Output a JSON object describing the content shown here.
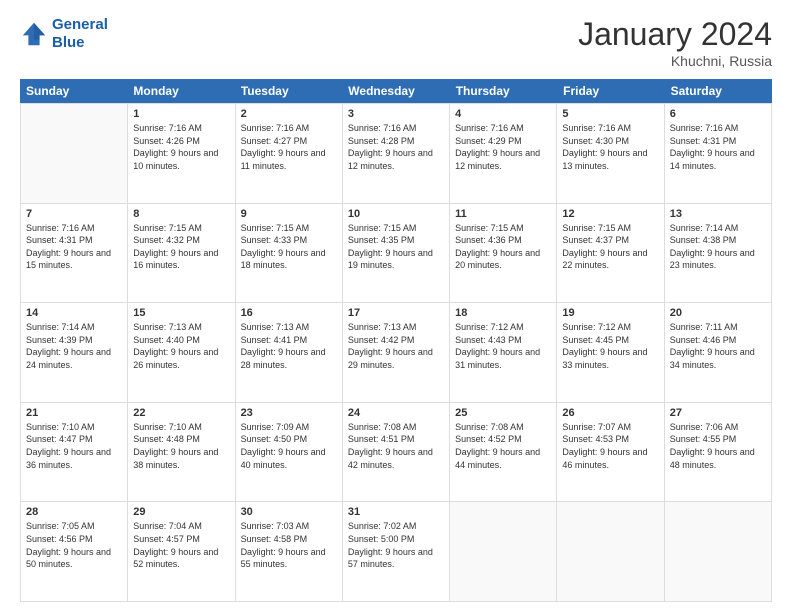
{
  "logo": {
    "line1": "General",
    "line2": "Blue"
  },
  "title": "January 2024",
  "location": "Khuchni, Russia",
  "days_of_week": [
    "Sunday",
    "Monday",
    "Tuesday",
    "Wednesday",
    "Thursday",
    "Friday",
    "Saturday"
  ],
  "weeks": [
    [
      {
        "day": "",
        "sunrise": "",
        "sunset": "",
        "daylight": ""
      },
      {
        "day": "1",
        "sunrise": "Sunrise: 7:16 AM",
        "sunset": "Sunset: 4:26 PM",
        "daylight": "Daylight: 9 hours and 10 minutes."
      },
      {
        "day": "2",
        "sunrise": "Sunrise: 7:16 AM",
        "sunset": "Sunset: 4:27 PM",
        "daylight": "Daylight: 9 hours and 11 minutes."
      },
      {
        "day": "3",
        "sunrise": "Sunrise: 7:16 AM",
        "sunset": "Sunset: 4:28 PM",
        "daylight": "Daylight: 9 hours and 12 minutes."
      },
      {
        "day": "4",
        "sunrise": "Sunrise: 7:16 AM",
        "sunset": "Sunset: 4:29 PM",
        "daylight": "Daylight: 9 hours and 12 minutes."
      },
      {
        "day": "5",
        "sunrise": "Sunrise: 7:16 AM",
        "sunset": "Sunset: 4:30 PM",
        "daylight": "Daylight: 9 hours and 13 minutes."
      },
      {
        "day": "6",
        "sunrise": "Sunrise: 7:16 AM",
        "sunset": "Sunset: 4:31 PM",
        "daylight": "Daylight: 9 hours and 14 minutes."
      }
    ],
    [
      {
        "day": "7",
        "sunrise": "Sunrise: 7:16 AM",
        "sunset": "Sunset: 4:31 PM",
        "daylight": "Daylight: 9 hours and 15 minutes."
      },
      {
        "day": "8",
        "sunrise": "Sunrise: 7:15 AM",
        "sunset": "Sunset: 4:32 PM",
        "daylight": "Daylight: 9 hours and 16 minutes."
      },
      {
        "day": "9",
        "sunrise": "Sunrise: 7:15 AM",
        "sunset": "Sunset: 4:33 PM",
        "daylight": "Daylight: 9 hours and 18 minutes."
      },
      {
        "day": "10",
        "sunrise": "Sunrise: 7:15 AM",
        "sunset": "Sunset: 4:35 PM",
        "daylight": "Daylight: 9 hours and 19 minutes."
      },
      {
        "day": "11",
        "sunrise": "Sunrise: 7:15 AM",
        "sunset": "Sunset: 4:36 PM",
        "daylight": "Daylight: 9 hours and 20 minutes."
      },
      {
        "day": "12",
        "sunrise": "Sunrise: 7:15 AM",
        "sunset": "Sunset: 4:37 PM",
        "daylight": "Daylight: 9 hours and 22 minutes."
      },
      {
        "day": "13",
        "sunrise": "Sunrise: 7:14 AM",
        "sunset": "Sunset: 4:38 PM",
        "daylight": "Daylight: 9 hours and 23 minutes."
      }
    ],
    [
      {
        "day": "14",
        "sunrise": "Sunrise: 7:14 AM",
        "sunset": "Sunset: 4:39 PM",
        "daylight": "Daylight: 9 hours and 24 minutes."
      },
      {
        "day": "15",
        "sunrise": "Sunrise: 7:13 AM",
        "sunset": "Sunset: 4:40 PM",
        "daylight": "Daylight: 9 hours and 26 minutes."
      },
      {
        "day": "16",
        "sunrise": "Sunrise: 7:13 AM",
        "sunset": "Sunset: 4:41 PM",
        "daylight": "Daylight: 9 hours and 28 minutes."
      },
      {
        "day": "17",
        "sunrise": "Sunrise: 7:13 AM",
        "sunset": "Sunset: 4:42 PM",
        "daylight": "Daylight: 9 hours and 29 minutes."
      },
      {
        "day": "18",
        "sunrise": "Sunrise: 7:12 AM",
        "sunset": "Sunset: 4:43 PM",
        "daylight": "Daylight: 9 hours and 31 minutes."
      },
      {
        "day": "19",
        "sunrise": "Sunrise: 7:12 AM",
        "sunset": "Sunset: 4:45 PM",
        "daylight": "Daylight: 9 hours and 33 minutes."
      },
      {
        "day": "20",
        "sunrise": "Sunrise: 7:11 AM",
        "sunset": "Sunset: 4:46 PM",
        "daylight": "Daylight: 9 hours and 34 minutes."
      }
    ],
    [
      {
        "day": "21",
        "sunrise": "Sunrise: 7:10 AM",
        "sunset": "Sunset: 4:47 PM",
        "daylight": "Daylight: 9 hours and 36 minutes."
      },
      {
        "day": "22",
        "sunrise": "Sunrise: 7:10 AM",
        "sunset": "Sunset: 4:48 PM",
        "daylight": "Daylight: 9 hours and 38 minutes."
      },
      {
        "day": "23",
        "sunrise": "Sunrise: 7:09 AM",
        "sunset": "Sunset: 4:50 PM",
        "daylight": "Daylight: 9 hours and 40 minutes."
      },
      {
        "day": "24",
        "sunrise": "Sunrise: 7:08 AM",
        "sunset": "Sunset: 4:51 PM",
        "daylight": "Daylight: 9 hours and 42 minutes."
      },
      {
        "day": "25",
        "sunrise": "Sunrise: 7:08 AM",
        "sunset": "Sunset: 4:52 PM",
        "daylight": "Daylight: 9 hours and 44 minutes."
      },
      {
        "day": "26",
        "sunrise": "Sunrise: 7:07 AM",
        "sunset": "Sunset: 4:53 PM",
        "daylight": "Daylight: 9 hours and 46 minutes."
      },
      {
        "day": "27",
        "sunrise": "Sunrise: 7:06 AM",
        "sunset": "Sunset: 4:55 PM",
        "daylight": "Daylight: 9 hours and 48 minutes."
      }
    ],
    [
      {
        "day": "28",
        "sunrise": "Sunrise: 7:05 AM",
        "sunset": "Sunset: 4:56 PM",
        "daylight": "Daylight: 9 hours and 50 minutes."
      },
      {
        "day": "29",
        "sunrise": "Sunrise: 7:04 AM",
        "sunset": "Sunset: 4:57 PM",
        "daylight": "Daylight: 9 hours and 52 minutes."
      },
      {
        "day": "30",
        "sunrise": "Sunrise: 7:03 AM",
        "sunset": "Sunset: 4:58 PM",
        "daylight": "Daylight: 9 hours and 55 minutes."
      },
      {
        "day": "31",
        "sunrise": "Sunrise: 7:02 AM",
        "sunset": "Sunset: 5:00 PM",
        "daylight": "Daylight: 9 hours and 57 minutes."
      },
      {
        "day": "",
        "sunrise": "",
        "sunset": "",
        "daylight": ""
      },
      {
        "day": "",
        "sunrise": "",
        "sunset": "",
        "daylight": ""
      },
      {
        "day": "",
        "sunrise": "",
        "sunset": "",
        "daylight": ""
      }
    ]
  ]
}
